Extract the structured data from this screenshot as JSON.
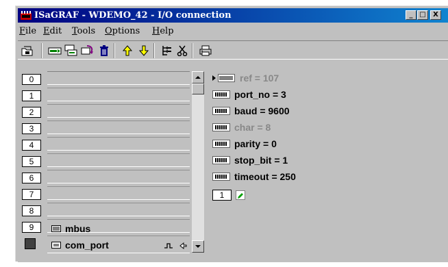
{
  "window": {
    "title": "ISaGRAF - WDEMO_42 - I/O connection",
    "controls": {
      "minimize": "_",
      "maximize": "□",
      "close": "X"
    }
  },
  "menu": [
    {
      "label": "File",
      "underline": "F",
      "rest": "ile"
    },
    {
      "label": "Edit",
      "underline": "E",
      "rest": "dit"
    },
    {
      "label": "Tools",
      "underline": "T",
      "rest": "ools"
    },
    {
      "label": "Options",
      "underline": "O",
      "rest": "ptions"
    },
    {
      "label": "Help",
      "underline": "H",
      "rest": "elp"
    }
  ],
  "toolbar": {
    "icons": [
      "open-icon",
      "set-board-icon",
      "copy-board-icon",
      "remove-board-icon",
      "delete-icon",
      "move-up-icon",
      "move-down-icon",
      "tree-icon",
      "cut-icon",
      "print-icon"
    ]
  },
  "slots": [
    {
      "num": "0",
      "board": ""
    },
    {
      "num": "1",
      "board": ""
    },
    {
      "num": "2",
      "board": ""
    },
    {
      "num": "3",
      "board": ""
    },
    {
      "num": "4",
      "board": ""
    },
    {
      "num": "5",
      "board": ""
    },
    {
      "num": "6",
      "board": ""
    },
    {
      "num": "7",
      "board": ""
    },
    {
      "num": "8",
      "board": ""
    },
    {
      "num": "9",
      "board": "mbus"
    },
    {
      "num": "",
      "board": "com_port"
    }
  ],
  "params": [
    {
      "text": "ref = 107",
      "dim": true
    },
    {
      "text": "port_no = 3",
      "dim": false
    },
    {
      "text": "baud = 9600",
      "dim": false
    },
    {
      "text": "char = 8",
      "dim": true
    },
    {
      "text": "parity = 0",
      "dim": false
    },
    {
      "text": "stop_bit = 1",
      "dim": false
    },
    {
      "text": "timeout = 250",
      "dim": false
    }
  ],
  "channel": {
    "num": "1"
  }
}
